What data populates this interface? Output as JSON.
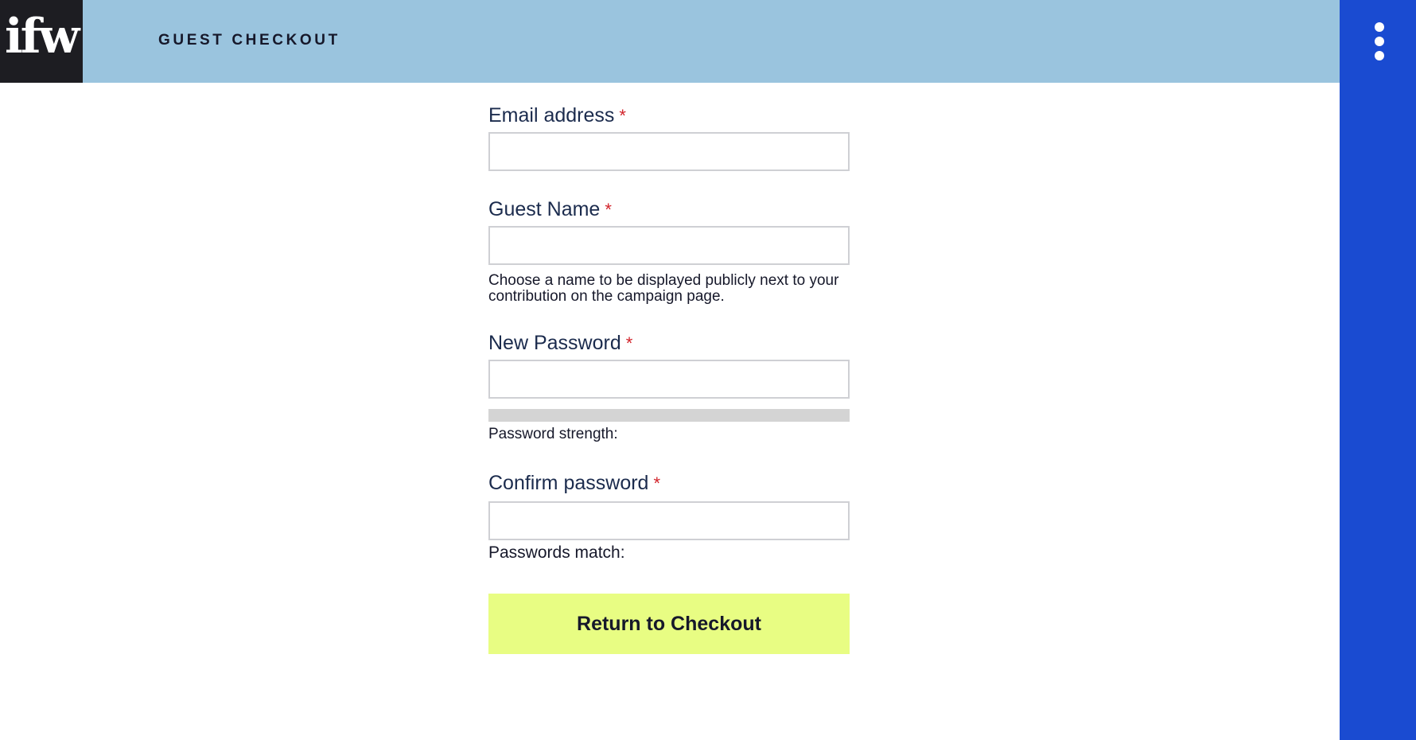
{
  "header": {
    "logo_text": "ifw",
    "title": "GUEST CHECKOUT"
  },
  "side_menu": {
    "icon": "vertical-ellipsis-icon"
  },
  "form": {
    "required_marker": "*",
    "email": {
      "label": "Email address",
      "value": "",
      "placeholder": ""
    },
    "guest_name": {
      "label": "Guest Name",
      "value": "",
      "placeholder": "",
      "help": "Choose a name to be displayed publicly next to your contribution on the campaign page."
    },
    "new_password": {
      "label": "New Password",
      "value": "",
      "placeholder": "",
      "strength_label": "Password strength:",
      "strength_fraction": 0
    },
    "confirm_password": {
      "label": "Confirm password",
      "value": "",
      "placeholder": "",
      "match_label": "Passwords match:"
    },
    "submit_label": "Return to Checkout"
  },
  "colors": {
    "header_bg": "#9ac4de",
    "logo_bg": "#1d1d22",
    "side_panel_bg": "#1a4bd1",
    "button_bg": "#e8fd83",
    "required": "#d2232a",
    "strength_track": "#d4d4d4"
  }
}
